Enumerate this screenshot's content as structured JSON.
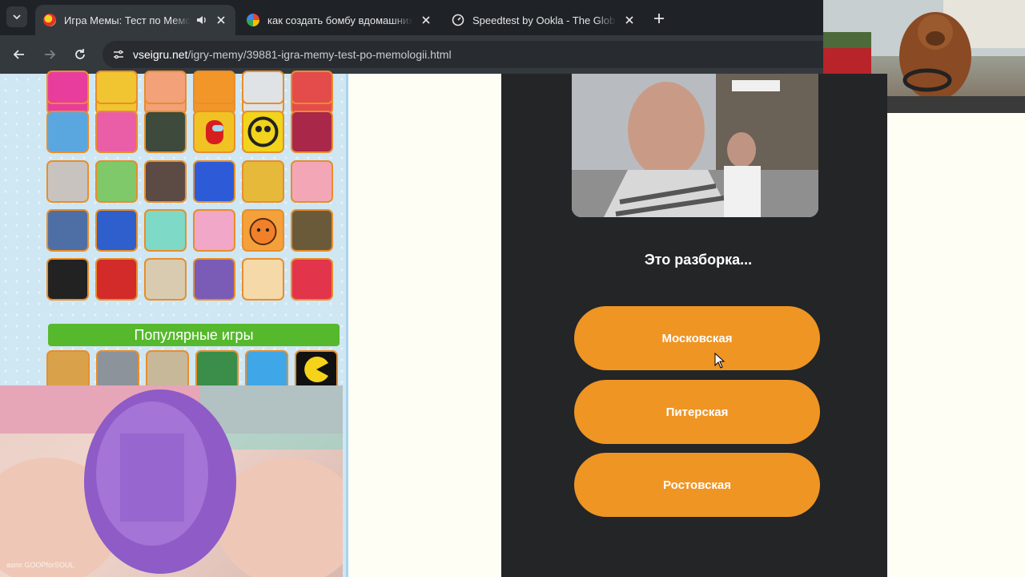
{
  "browser": {
    "tabs": [
      {
        "title": "Игра Мемы: Тест по Мемологии",
        "active": true,
        "audio": true
      },
      {
        "title": "как создать бомбу вдомашних условиях",
        "active": false
      },
      {
        "title": "Speedtest by Ookla - The Global Broadband Speed Test",
        "active": false
      }
    ],
    "url_host": "vseigru.net",
    "url_path": "/igry-memy/39881-igra-memy-test-po-memologii.html"
  },
  "sidebar": {
    "popular_label": "Популярные игры",
    "video_credit": "asmr GOOPforSOUL"
  },
  "quiz": {
    "question": "Это разборка...",
    "answers": [
      "Московская",
      "Питерская",
      "Ростовская"
    ]
  },
  "colors": {
    "accent": "#ef9524",
    "panel_bg": "#232527",
    "popular_bar": "#56b92d"
  }
}
